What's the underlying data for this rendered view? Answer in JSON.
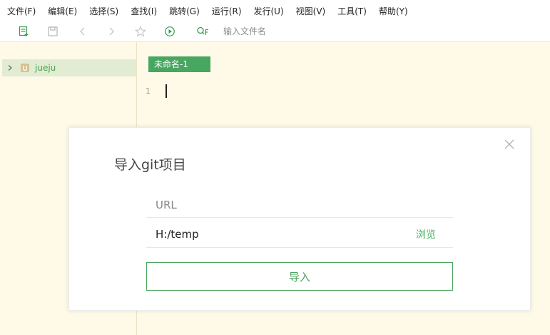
{
  "menubar": {
    "items": [
      "文件(F)",
      "编辑(E)",
      "选择(S)",
      "查找(I)",
      "跳转(G)",
      "运行(R)",
      "发行(U)",
      "视图(V)",
      "工具(T)",
      "帮助(Y)"
    ]
  },
  "toolbar": {
    "icons": [
      "new-file-icon",
      "save-icon",
      "back-icon",
      "forward-icon",
      "star-icon",
      "run-icon",
      "search-file-icon"
    ],
    "search_placeholder": "输入文件名"
  },
  "sidebar": {
    "project": {
      "label": "jueju",
      "icon": "project-icon"
    }
  },
  "editor": {
    "tab_label": "未命名-1",
    "line_number": "1"
  },
  "dialog": {
    "title": "导入git项目",
    "url_placeholder": "URL",
    "path_value": "H:/temp",
    "browse_label": "浏览",
    "import_button_label": "导入"
  },
  "colors": {
    "accent_green": "#47a660",
    "background": "#fffae8",
    "sidebar_selection": "#e2ecd2"
  }
}
